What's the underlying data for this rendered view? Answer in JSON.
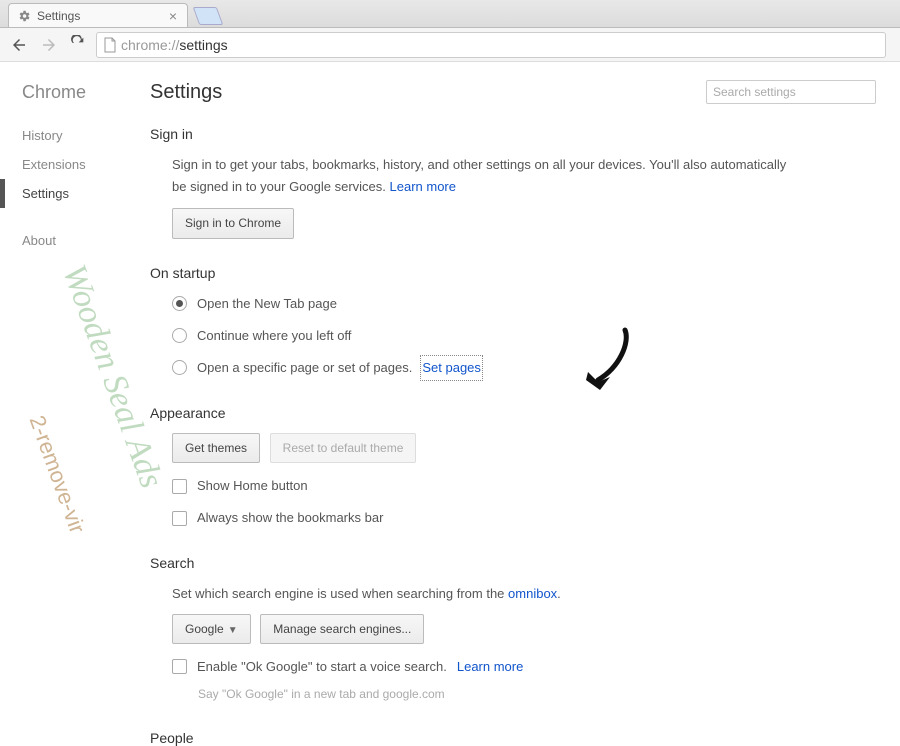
{
  "tab": {
    "title": "Settings"
  },
  "omnibox": {
    "prefix": "chrome://",
    "path": "settings"
  },
  "sidebar": {
    "title": "Chrome",
    "items": [
      {
        "label": "History",
        "active": false
      },
      {
        "label": "Extensions",
        "active": false
      },
      {
        "label": "Settings",
        "active": true
      }
    ],
    "about": "About"
  },
  "header": {
    "title": "Settings",
    "search_placeholder": "Search settings"
  },
  "signin": {
    "title": "Sign in",
    "desc1": "Sign in to get your tabs, bookmarks, history, and other settings on all your devices. You'll also automatically",
    "desc2": "be signed in to your Google services. ",
    "learn_more": "Learn more",
    "button": "Sign in to Chrome"
  },
  "startup": {
    "title": "On startup",
    "opt1": "Open the New Tab page",
    "opt2": "Continue where you left off",
    "opt3": "Open a specific page or set of pages. ",
    "set_pages": "Set pages"
  },
  "appearance": {
    "title": "Appearance",
    "get_themes": "Get themes",
    "reset_theme": "Reset to default theme",
    "show_home": "Show Home button",
    "show_bookmarks": "Always show the bookmarks bar"
  },
  "search": {
    "title": "Search",
    "desc_pre": "Set which search engine is used when searching from the ",
    "omnibox_link": "omnibox",
    "engine": "Google",
    "manage": "Manage search engines...",
    "ok_google_pre": "Enable \"Ok Google\" to start a voice search. ",
    "ok_google_learn": "Learn more",
    "ok_google_hint": "Say \"Ok Google\" in a new tab and google.com"
  },
  "people": {
    "title": "People"
  },
  "watermarks": {
    "w1": "Wooden Seal Ads",
    "w2": "2-remove-vir"
  }
}
